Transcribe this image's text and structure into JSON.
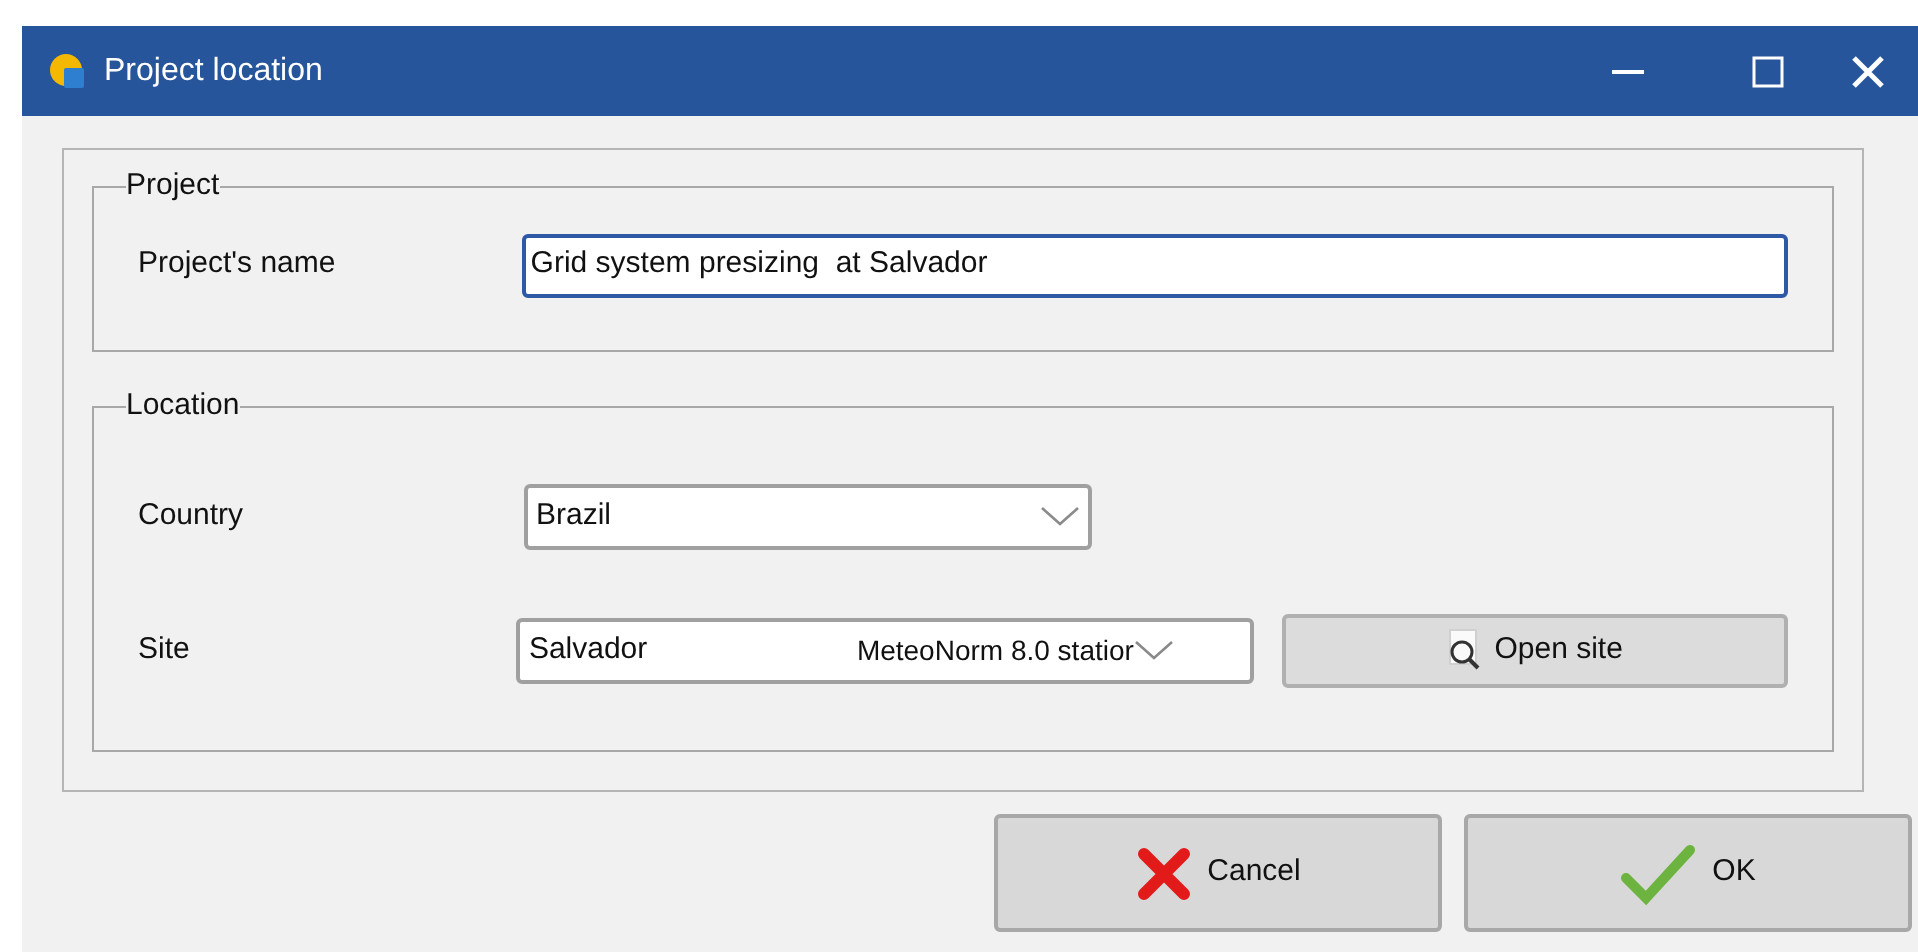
{
  "window": {
    "title": "Project location"
  },
  "project_group": {
    "legend": "Project",
    "name_label": "Project's name",
    "name_value": "Grid system presizing  at Salvador"
  },
  "location_group": {
    "legend": "Location",
    "country_label": "Country",
    "country_value": "Brazil",
    "site_label": "Site",
    "site_value": "Salvador",
    "site_source": "MeteoNorm 8.0 statior",
    "open_site_button": "Open site"
  },
  "buttons": [
    {
      "kind": "cancel",
      "label": "Cancel"
    },
    {
      "kind": "ok",
      "label": "OK"
    }
  ]
}
